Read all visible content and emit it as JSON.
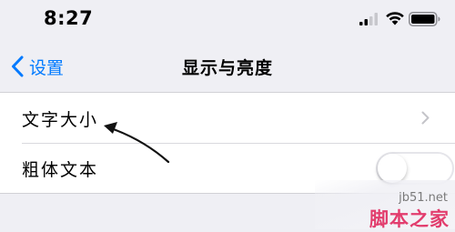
{
  "status_bar": {
    "time": "8:27",
    "signal_icon": "cellular-signal-icon",
    "wifi_icon": "wifi-icon",
    "battery_icon": "battery-icon"
  },
  "nav": {
    "back_label": "设置",
    "back_icon": "chevron-left-icon",
    "title": "显示与亮度"
  },
  "settings": {
    "rows": [
      {
        "label": "文字大小",
        "accessory": "chevron-right-icon"
      },
      {
        "label": "粗体文本",
        "accessory": "toggle",
        "toggle_on": false
      }
    ]
  },
  "annotation": {
    "icon": "curved-arrow-icon"
  },
  "watermark": {
    "url": "jb51.net",
    "name": "脚本之家"
  },
  "colors": {
    "accent": "#007aff",
    "background": "#efeff4",
    "watermark": "#e23d6d"
  }
}
